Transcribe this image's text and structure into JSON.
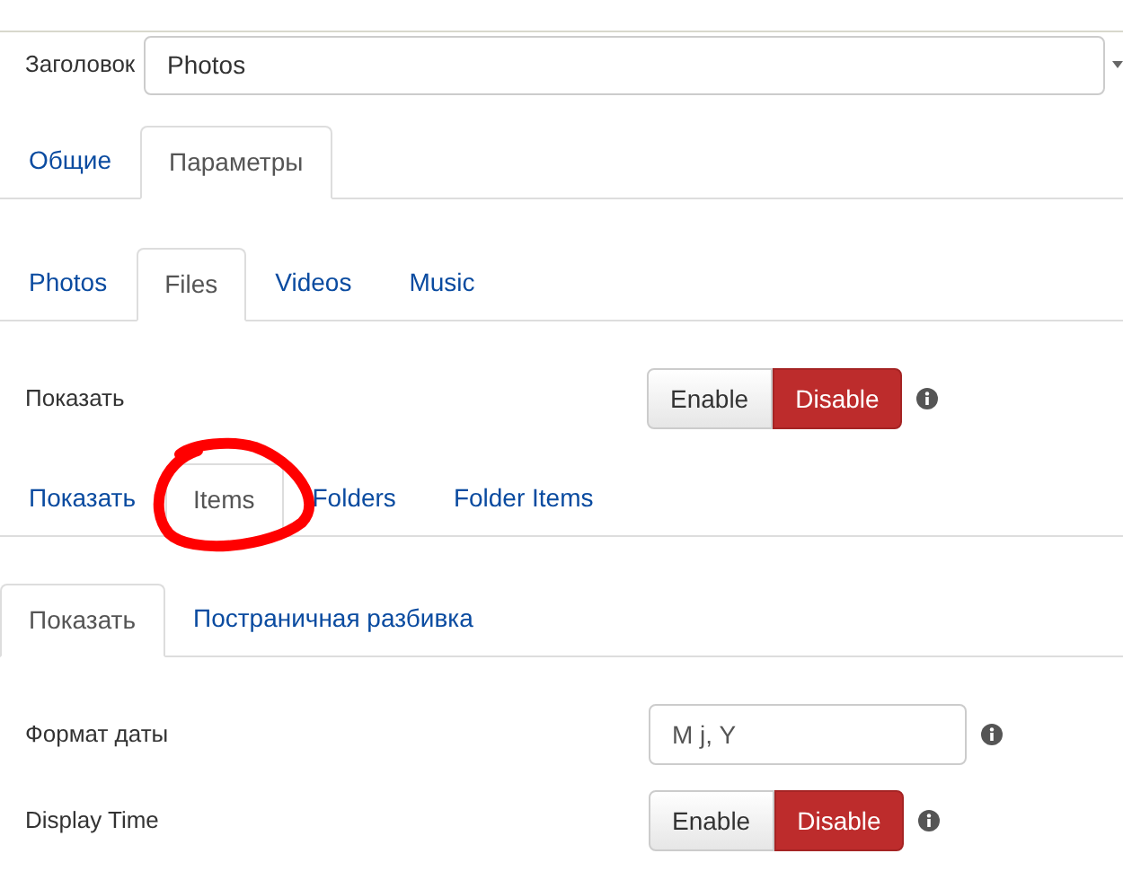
{
  "title_field": {
    "label": "Заголовок",
    "value": "Photos"
  },
  "main_tabs": [
    {
      "label": "Общие",
      "selected": false
    },
    {
      "label": "Параметры",
      "selected": true
    }
  ],
  "section_tabs": [
    {
      "label": "Photos",
      "selected": false
    },
    {
      "label": "Files",
      "selected": true
    },
    {
      "label": "Videos",
      "selected": false
    },
    {
      "label": "Music",
      "selected": false
    }
  ],
  "show_setting": {
    "label": "Показать",
    "options": [
      {
        "label": "Enable",
        "selected": false
      },
      {
        "label": "Disable",
        "selected": true
      }
    ]
  },
  "sub_tabs": [
    {
      "label": "Показать",
      "selected": false
    },
    {
      "label": "Items",
      "selected": true
    },
    {
      "label": "Folders",
      "selected": false
    },
    {
      "label": "Folder Items",
      "selected": false
    }
  ],
  "items_tabs": [
    {
      "label": "Показать",
      "selected": true
    },
    {
      "label": "Постраничная разбивка",
      "selected": false
    }
  ],
  "fields": [
    {
      "kind": "text",
      "label": "Формат даты",
      "value": "M j, Y"
    },
    {
      "kind": "toggle",
      "label": "Display Time",
      "options": [
        {
          "label": "Enable",
          "selected": false
        },
        {
          "label": "Disable",
          "selected": true
        }
      ]
    }
  ]
}
